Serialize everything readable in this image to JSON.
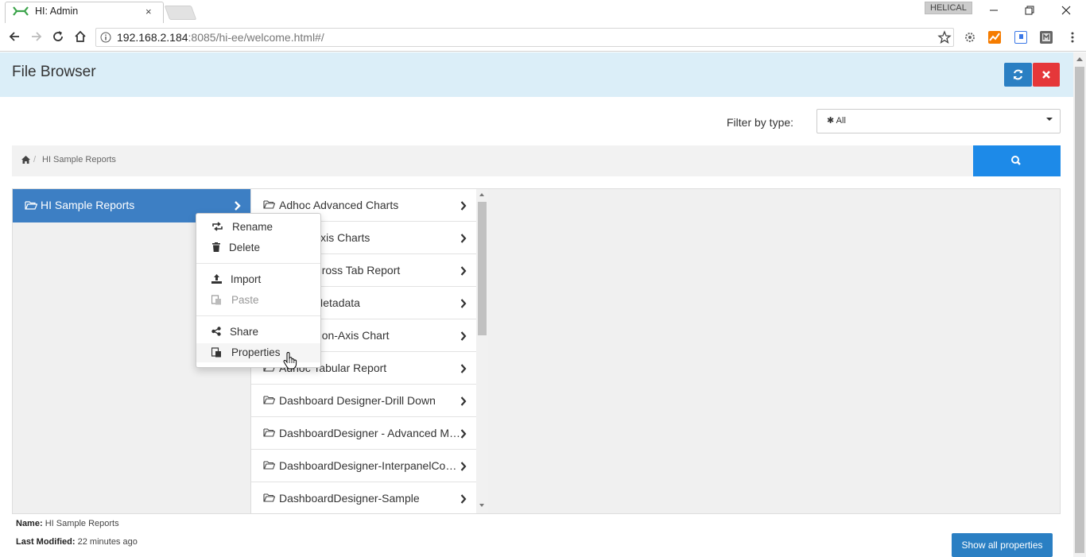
{
  "browser": {
    "tab_title": "HI: Admin",
    "tab_close": "×",
    "profile_name": "HELICAL",
    "url_host": "192.168.2.184",
    "url_rest": ":8085/hi-ee/welcome.html#/"
  },
  "header": {
    "title": "File Browser"
  },
  "filter": {
    "label": "Filter by type:",
    "value": "✱ All"
  },
  "breadcrumb": {
    "separator": "/",
    "current": "HI Sample Reports"
  },
  "tree": {
    "selected_folder": "HI Sample Reports",
    "items": [
      {
        "label": "Adhoc Advanced Charts"
      },
      {
        "label": "Adhoc Axis Charts"
      },
      {
        "label": "Adhoc Cross Tab Report"
      },
      {
        "label": "Adhoc Metadata"
      },
      {
        "label": "Adhoc Non-Axis Chart"
      },
      {
        "label": "Adhoc Tabular Report"
      },
      {
        "label": "Dashboard Designer-Drill Down"
      },
      {
        "label": "DashboardDesigner - Advanced Metrics"
      },
      {
        "label": "DashboardDesigner-InterpanelCommunication"
      },
      {
        "label": "DashboardDesigner-Sample"
      }
    ]
  },
  "context_menu": {
    "rename": "Rename",
    "delete": "Delete",
    "import": "Import",
    "paste": "Paste",
    "share": "Share",
    "properties": "Properties"
  },
  "info": {
    "name_label": "Name:",
    "name_value": "HI Sample Reports",
    "modified_label": "Last Modified:",
    "modified_value": "22 minutes ago"
  },
  "buttons": {
    "show_all": "Show all properties"
  },
  "colors": {
    "header_bg": "#dbeef8",
    "primary": "#2a7fc3",
    "danger": "#e5373a",
    "search": "#1d8ae8",
    "selected_folder": "#3d7fc4"
  }
}
